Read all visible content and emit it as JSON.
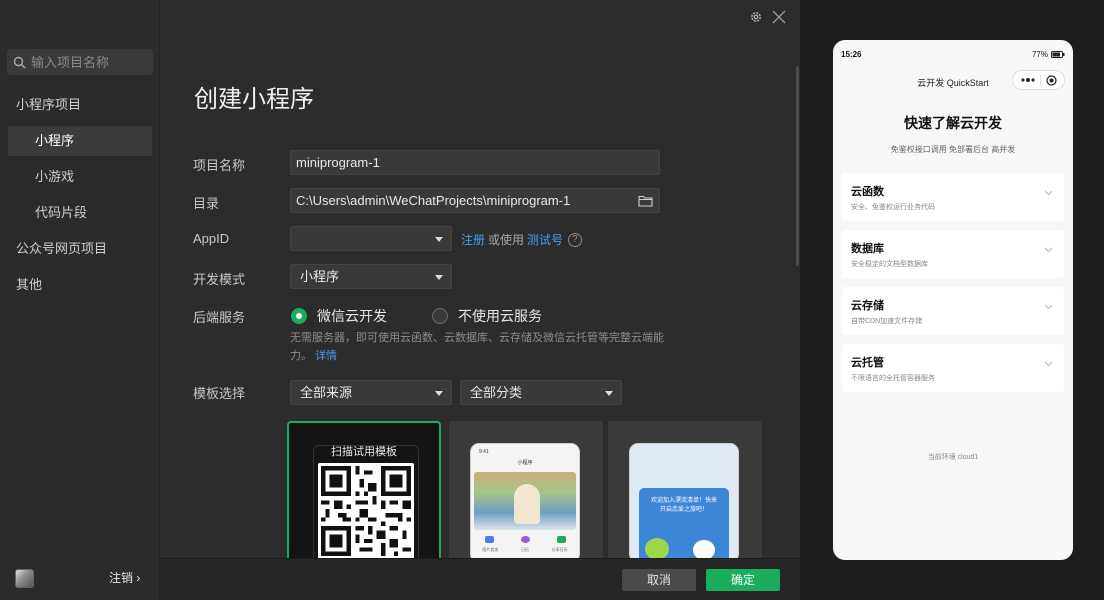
{
  "sidebar": {
    "search_placeholder": "输入项目名称",
    "items": [
      {
        "label": "小程序项目"
      },
      {
        "label": "小程序"
      },
      {
        "label": "小游戏"
      },
      {
        "label": "代码片段"
      },
      {
        "label": "公众号网页项目"
      },
      {
        "label": "其他"
      }
    ],
    "logout_label": "注销 ›"
  },
  "main": {
    "title": "创建小程序",
    "form": {
      "name_label": "项目名称",
      "name_value": "miniprogram-1",
      "dir_label": "目录",
      "dir_value": "C:\\Users\\admin\\WeChatProjects\\miniprogram-1",
      "appid_label": "AppID",
      "appid_value": "",
      "register_link": "注册",
      "or_use": "或使用",
      "test_link": "测试号",
      "help_icon_text": "?",
      "mode_label": "开发模式",
      "mode_value": "小程序",
      "backend_label": "后端服务",
      "backend_option_cloud": "微信云开发",
      "backend_option_none": "不使用云服务",
      "backend_hint": "无需服务器，即可使用云函数、云数据库、云存储及微信云托管等完整云端能力。",
      "details_link": "详情",
      "template_label": "模板选择",
      "source_value": "全部来源",
      "category_value": "全部分类"
    },
    "templates": [
      {
        "label": "扫描试用模板"
      },
      {
        "label": "小程序"
      },
      {
        "label": "欢迎加入漂流清单！快来开启恋爱之旅吧！"
      }
    ],
    "template_2": {
      "time": "9:41",
      "tabs": [
        "图片首发",
        "日历",
        "分享日历"
      ]
    },
    "cancel_label": "取消",
    "confirm_label": "确定"
  },
  "preview": {
    "time": "15:26",
    "battery": "77%",
    "nav_title": "云开发 QuickStart",
    "hero_title": "快速了解云开发",
    "hero_subtitle": "免鉴权接口调用 免部署后台 高并发",
    "cards": [
      {
        "title": "云函数",
        "desc": "安全、免鉴权运行业务代码"
      },
      {
        "title": "数据库",
        "desc": "安全稳定的文档型数据库"
      },
      {
        "title": "云存储",
        "desc": "自带CDN加速文件存储"
      },
      {
        "title": "云托管",
        "desc": "不限语言的全托管容器服务"
      }
    ],
    "env_text": "当前环境 cloud1"
  },
  "colors": {
    "accent": "#1aad5c",
    "link": "#4c9cf6"
  }
}
